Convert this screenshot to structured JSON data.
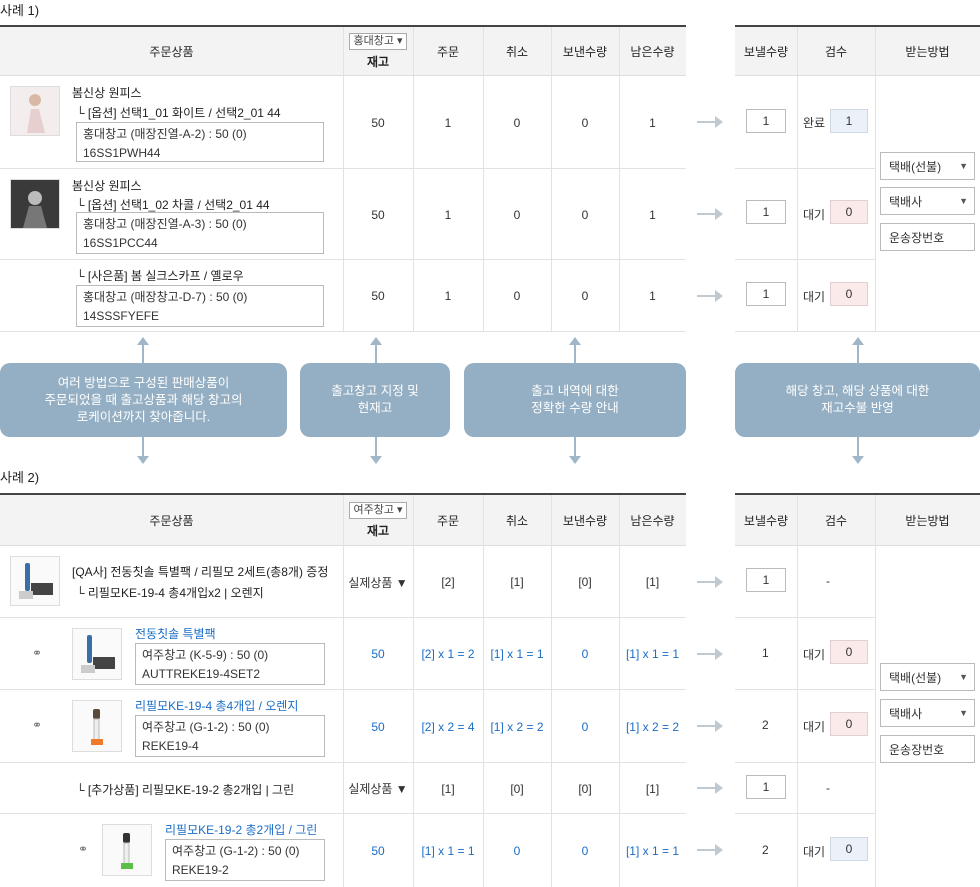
{
  "section1": {
    "label": "사례 1)"
  },
  "section2": {
    "label": "사례 2)"
  },
  "headers": {
    "product": "주문상품",
    "stock": "재고",
    "order": "주문",
    "cancel": "취소",
    "sent": "보낸수량",
    "remain": "남은수량",
    "send_qty": "보낼수량",
    "inspect": "검수",
    "method": "받는방법"
  },
  "t1": {
    "warehouse_select": "홍대창고 ▾",
    "rows": [
      {
        "title": "봄신상 원피스",
        "option": "└ [옵션] 선택1_01 화이트 / 선택2_01 44",
        "loc": "홍대창고 (매장진열-A-2) : 50 (0)",
        "sku": "16SS1PWH44",
        "stock": "50",
        "order": "1",
        "cancel": "0",
        "sent": "0",
        "remain": "1",
        "qty": "1",
        "status": "완료",
        "check": "1"
      },
      {
        "title": "봄신상 원피스",
        "option": "└ [옵션] 선택1_02 차콜 / 선택2_01 44",
        "loc": "홍대창고 (매장진열-A-3) : 50 (0)",
        "sku": "16SS1PCC44",
        "stock": "50",
        "order": "1",
        "cancel": "0",
        "sent": "0",
        "remain": "1",
        "qty": "1",
        "status": "대기",
        "check": "0"
      },
      {
        "option": "└ [사은품] 봄 실크스카프 / 옐로우",
        "loc": "홍대창고 (매장창고-D-7) : 50 (0)",
        "sku": "14SSSFYEFE",
        "stock": "50",
        "order": "1",
        "cancel": "0",
        "sent": "0",
        "remain": "1",
        "qty": "1",
        "status": "대기",
        "check": "0"
      }
    ],
    "ship_method": "택배(선불)",
    "courier": "택배사",
    "tracking": "운송장번호"
  },
  "info": [
    "여러 방법으로 구성된 판매상품이\n주문되었을 때 출고상품과 해당 창고의\n로케이션까지 찾아줍니다.",
    "출고창고 지정 및\n현재고",
    "출고 내역에 대한\n정확한 수량 안내",
    "해당 창고, 해당 상품에 대한\n재고수불 반영"
  ],
  "t2": {
    "warehouse_select": "여주창고 ▾",
    "rows": [
      {
        "title": "[QA사] 전동칫솔 특별팩 / 리필모 2세트(총8개) 증정",
        "option": "└ 리필모KE-19-4 총4개입x2 | 오렌지",
        "stock": "실제상품 ▼",
        "order": "[2]",
        "cancel": "[1]",
        "sent": "[0]",
        "remain": "[1]",
        "qty": "1",
        "inspect": "-"
      },
      {
        "title": "전동칫솔 특별팩",
        "loc": "여주창고 (K-5-9) : 50 (0)",
        "sku": "AUTTREKE19-4SET2",
        "stock": "50",
        "order": "[2] x 1 = 2",
        "cancel": "[1] x 1 = 1",
        "sent": "0",
        "remain": "[1] x 1 = 1",
        "qty": "1",
        "status": "대기",
        "check": "0"
      },
      {
        "title": "리필모KE-19-4 총4개입 / 오렌지",
        "loc": "여주창고 (G-1-2) : 50 (0)",
        "sku": "REKE19-4",
        "stock": "50",
        "order": "[2] x 2 = 4",
        "cancel": "[1] x 2 = 2",
        "sent": "0",
        "remain": "[1] x 2 = 2",
        "qty": "2",
        "status": "대기",
        "check": "0"
      },
      {
        "option": "└ [추가상품] 리필모KE-19-2 총2개입 | 그린",
        "stock": "실제상품 ▼",
        "order": "[1]",
        "cancel": "[0]",
        "sent": "[0]",
        "remain": "[1]",
        "qty": "1",
        "inspect": "-"
      },
      {
        "title": "리필모KE-19-2 총2개입 / 그린",
        "loc": "여주창고 (G-1-2) : 50 (0)",
        "sku": "REKE19-2",
        "stock": "50",
        "order": "[1] x 1 = 1",
        "cancel": "0",
        "sent": "0",
        "remain": "[1] x 1 = 1",
        "qty": "2",
        "status": "대기",
        "check": "0"
      }
    ],
    "ship_method": "택배(선불)",
    "courier": "택배사",
    "tracking": "운송장번호"
  }
}
